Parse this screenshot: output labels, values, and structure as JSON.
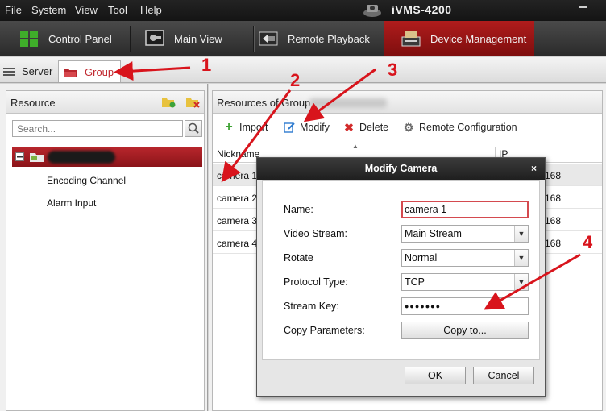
{
  "menu": [
    "File",
    "System",
    "View",
    "Tool",
    "Help"
  ],
  "app_title": "iVMS-4200",
  "modules": [
    {
      "label": "Control Panel",
      "icon": "grid-icon"
    },
    {
      "label": "Main View",
      "icon": "camera-view-icon"
    },
    {
      "label": "Remote Playback",
      "icon": "playback-icon"
    },
    {
      "label": "Device Management",
      "icon": "device-icon",
      "active": true
    }
  ],
  "subtabs": [
    {
      "label": "Server",
      "icon": "server-icon"
    },
    {
      "label": "Group",
      "icon": "folder-icon",
      "active": true
    }
  ],
  "left_panel": {
    "title": "Resource",
    "search_placeholder": "Search...",
    "tree": {
      "children": [
        "Encoding Channel",
        "Alarm Input"
      ]
    }
  },
  "right_panel": {
    "title": "Resources of Group",
    "toolbar": [
      "Import",
      "Modify",
      "Delete",
      "Remote Configuration"
    ],
    "columns": [
      "Nickname",
      "IP"
    ],
    "rows": [
      {
        "nickname": "camera 1",
        "ip": "168",
        "selected": true
      },
      {
        "nickname": "camera 2",
        "ip": "168"
      },
      {
        "nickname": "camera 3",
        "ip": "168"
      },
      {
        "nickname": "camera 4",
        "ip": "168"
      }
    ]
  },
  "dialog": {
    "title": "Modify Camera",
    "close": "×",
    "labels": {
      "name": "Name:",
      "video_stream": "Video Stream:",
      "rotate": "Rotate",
      "protocol": "Protocol Type:",
      "stream_key": "Stream Key:",
      "copy_params": "Copy Parameters:"
    },
    "values": {
      "name": "camera 1",
      "video_stream": "Main Stream",
      "rotate": "Normal",
      "protocol": "TCP",
      "stream_key": "●●●●●●●"
    },
    "copy_to": "Copy to...",
    "ok": "OK",
    "cancel": "Cancel"
  },
  "annotations": {
    "n1": "1",
    "n2": "2",
    "n3": "3",
    "n4": "4",
    "color": "#d8141c"
  }
}
